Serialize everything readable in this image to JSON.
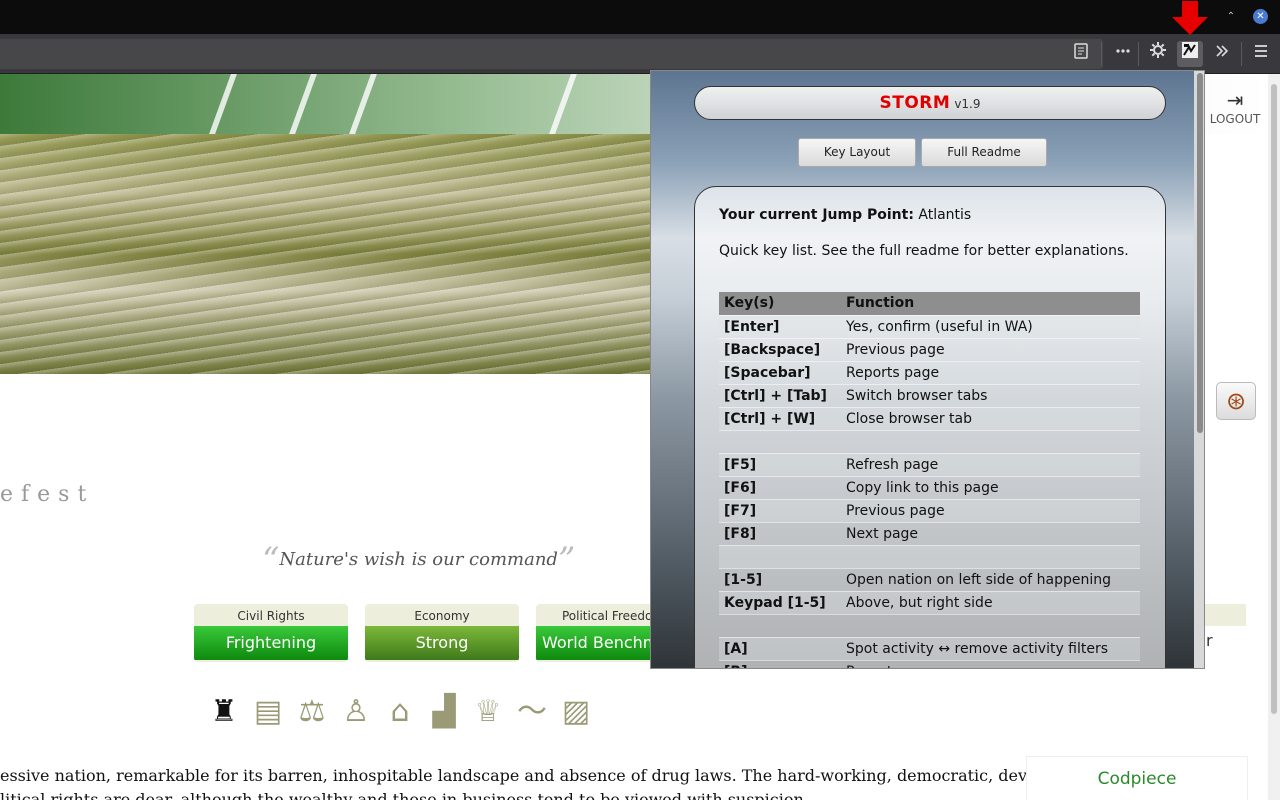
{
  "browser": {
    "minimize_glyph": "⌃",
    "close_glyph": "✕",
    "toolbar_icons": [
      "reader-icon",
      "more-icon",
      "settings-icon",
      "storm-extension-icon",
      "overflow-icon",
      "menu-icon"
    ]
  },
  "page": {
    "logout_label": "LOGOUT",
    "nation_name_partial": "efest",
    "motto": "Nature's wish is our command",
    "stats": [
      {
        "label": "Civil Rights",
        "value": "Frightening"
      },
      {
        "label": "Economy",
        "value": "Strong"
      },
      {
        "label": "Political Freedom",
        "value": "World Benchmark"
      }
    ],
    "category_icons": [
      "monument-icon",
      "newspaper-icon",
      "scales-icon",
      "person-icon",
      "government-icon",
      "factory-icon",
      "trophy-icon",
      "trend-icon",
      "cards-icon"
    ],
    "description_line1": "essive nation, remarkable for its barren, inhospitable landscape and absence of drug laws. The hard-working, democratic, devout",
    "description_line2": "litical rights are dear, although the wealthy and those in business tend to be viewed with suspicion.",
    "side_card_name": "Codpiece",
    "side_r": "r"
  },
  "popup": {
    "title": "STORM",
    "version": "v1.9",
    "buttons": {
      "key_layout": "Key Layout",
      "full_readme": "Full Readme"
    },
    "jump_label": "Your current Jump Point:",
    "jump_value": "Atlantis",
    "quick_text": "Quick key list. See the full readme for better explanations.",
    "table_headers": [
      "Key(s)",
      "Function"
    ],
    "rows": [
      {
        "key": "[Enter]",
        "fn": "Yes, confirm (useful in WA)"
      },
      {
        "key": "[Backspace]",
        "fn": "Previous page"
      },
      {
        "key": "[Spacebar]",
        "fn": "Reports page"
      },
      {
        "key": "[Ctrl] + [Tab]",
        "fn": "Switch browser tabs"
      },
      {
        "key": "[Ctrl] + [W]",
        "fn": "Close browser tab"
      },
      {
        "key": "",
        "fn": ""
      },
      {
        "key": "[F5]",
        "fn": "Refresh page"
      },
      {
        "key": "[F6]",
        "fn": "Copy link to this page"
      },
      {
        "key": "[F7]",
        "fn": "Previous page"
      },
      {
        "key": "[F8]",
        "fn": "Next page"
      },
      {
        "key": "",
        "fn": ""
      },
      {
        "key": "[1-5]",
        "fn": "Open nation on left side of happening"
      },
      {
        "key": "Keypad [1-5]",
        "fn": "Above, but right side"
      },
      {
        "key": "",
        "fn": ""
      },
      {
        "key": "[A]",
        "fn": "Spot activity ↔ remove activity filters"
      },
      {
        "key": "[R]",
        "fn": "Reports"
      }
    ]
  }
}
